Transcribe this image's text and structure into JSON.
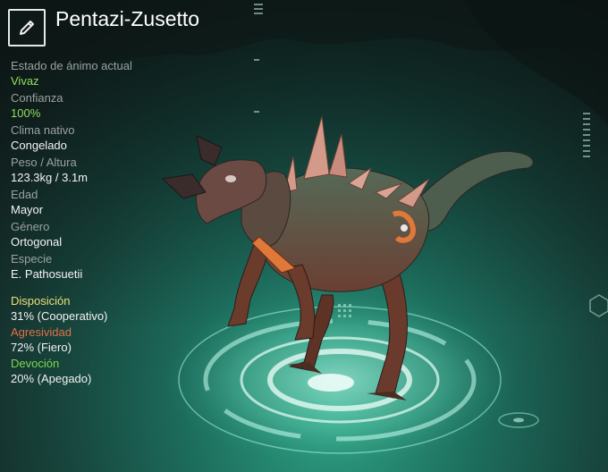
{
  "header": {
    "title": "Pentazi-Zusetto",
    "edit_icon": "pencil-icon"
  },
  "stats": [
    {
      "label": "Estado de ánimo actual",
      "value": "Vivaz",
      "highlight": true
    },
    {
      "label": "Confianza",
      "value": "100%",
      "highlight": true
    },
    {
      "label": "Clima nativo",
      "value": "Congelado",
      "highlight": false
    },
    {
      "label": "Peso / Altura",
      "value": "123.3kg / 3.1m",
      "highlight": false
    },
    {
      "label": "Edad",
      "value": "Mayor",
      "highlight": false
    },
    {
      "label": "Género",
      "value": "Ortogonal",
      "highlight": false
    },
    {
      "label": "Especie",
      "value": "E. Pathosuetii",
      "highlight": false
    }
  ],
  "traits": [
    {
      "label": "Disposición",
      "value": "31% (Cooperativo)",
      "color": "#e8e07a"
    },
    {
      "label": "Agresividad",
      "value": "72% (Fiero)",
      "color": "#e0704a"
    },
    {
      "label": "Devoción",
      "value": "20% (Apegado)",
      "color": "#7cd64e"
    }
  ],
  "colors": {
    "accent_green": "#8de05c",
    "creature_body": "#5e3c31",
    "creature_scales": "#3f5a4a",
    "creature_spikes": "#d39a8a",
    "harness": "#e0783a",
    "platform_glow": "#9ff5dc"
  }
}
